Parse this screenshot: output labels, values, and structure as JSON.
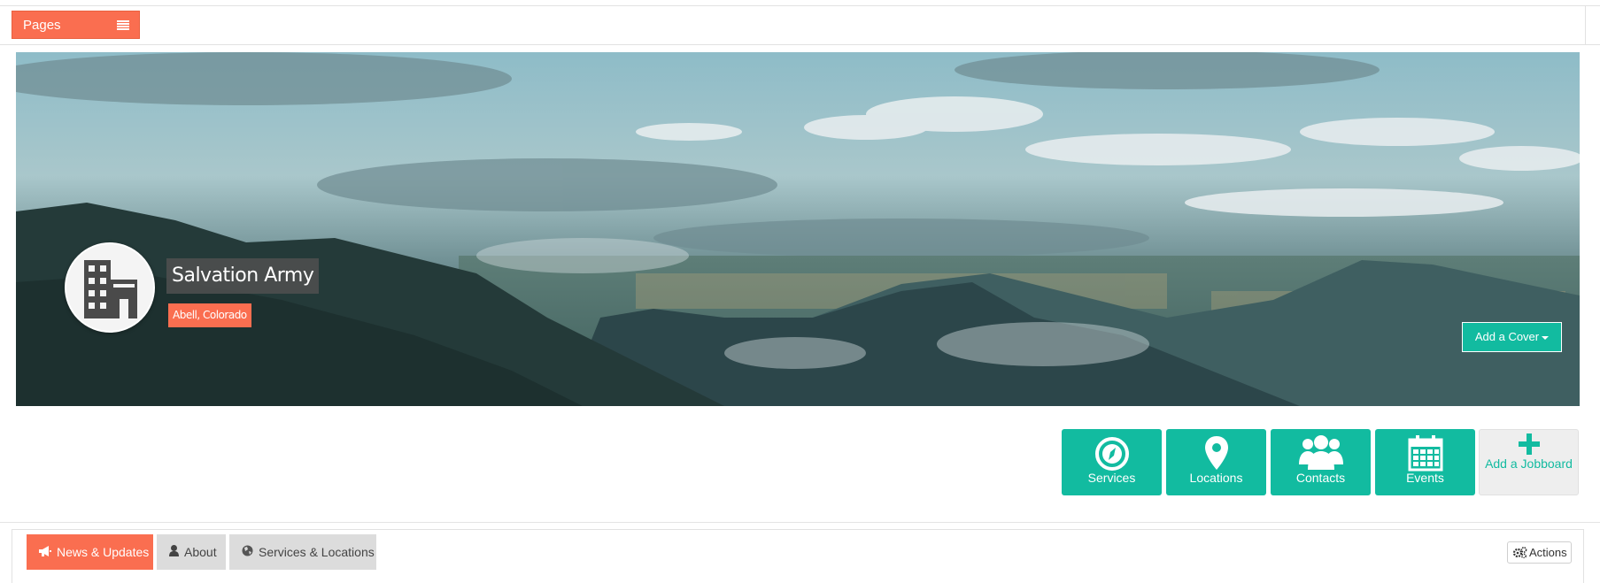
{
  "topbar": {
    "pages_label": "Pages",
    "menu_icon": "hamburger-icon"
  },
  "profile": {
    "name": "Salvation Army",
    "location": "Abell, Colorado",
    "avatar_icon": "building-icon",
    "add_cover_label": "Add a Cover"
  },
  "tiles": [
    {
      "label": "Services",
      "icon": "compass-icon"
    },
    {
      "label": "Locations",
      "icon": "map-pin-icon"
    },
    {
      "label": "Contacts",
      "icon": "users-icon"
    },
    {
      "label": "Events",
      "icon": "calendar-icon"
    },
    {
      "label": "Add a Jobboard",
      "icon": "plus-icon"
    }
  ],
  "tabs": [
    {
      "label": "News & Updates",
      "icon": "megaphone-icon",
      "active": true
    },
    {
      "label": "About",
      "icon": "user-icon",
      "active": false
    },
    {
      "label": "Services & Locations",
      "icon": "globe-icon",
      "active": false
    }
  ],
  "actions_label": "Actions",
  "colors": {
    "accent": "#fa6e50",
    "teal": "#12bba0",
    "tab_inactive": "#dcdcdc"
  }
}
